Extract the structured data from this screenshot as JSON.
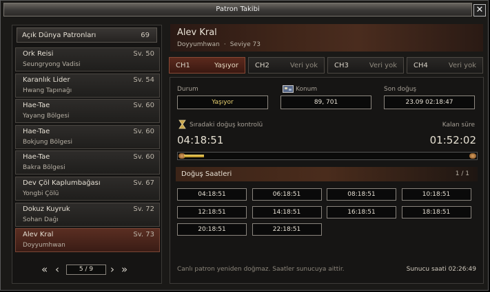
{
  "window": {
    "title": "Patron Takibi",
    "close_label": "✕"
  },
  "list": {
    "header_label": "Açık Dünya Patronları",
    "header_count": "69",
    "items": [
      {
        "name": "Ork Reisi",
        "level": "Sv. 50",
        "zone": "Seungryong Vadisi"
      },
      {
        "name": "Karanlık Lider",
        "level": "Sv. 54",
        "zone": "Hwang Tapınağı"
      },
      {
        "name": "Hae-Tae",
        "level": "Sv. 60",
        "zone": "Yayang Bölgesi"
      },
      {
        "name": "Hae-Tae",
        "level": "Sv. 60",
        "zone": "Bokjung Bölgesi"
      },
      {
        "name": "Hae-Tae",
        "level": "Sv. 60",
        "zone": "Bakra Bölgesi"
      },
      {
        "name": "Dev Çöl Kaplumbağası",
        "level": "Sv. 67",
        "zone": "Yongbi Çölü"
      },
      {
        "name": "Dokuz Kuyruk",
        "level": "Sv. 72",
        "zone": "Sohan Dağı"
      },
      {
        "name": "Alev Kral",
        "level": "Sv. 73",
        "zone": "Doyyumhwan"
      }
    ],
    "active_index": 7,
    "pager": {
      "label": "5 / 9",
      "first": "«",
      "prev": "‹",
      "next": "›",
      "last": "»"
    }
  },
  "boss": {
    "name": "Alev Kral",
    "zone": "Doyyumhwan",
    "separator": "·",
    "level": "Seviye 73"
  },
  "tabs": [
    {
      "name": "CH1",
      "status": "Yaşıyor"
    },
    {
      "name": "CH2",
      "status": "Veri yok"
    },
    {
      "name": "CH3",
      "status": "Veri yok"
    },
    {
      "name": "CH4",
      "status": "Veri yok"
    }
  ],
  "active_tab": 0,
  "details": {
    "status_label": "Durum",
    "status_value": "Yaşıyor",
    "location_label": "Konum",
    "location_value": "89, 701",
    "last_spawn_label": "Son doğuş",
    "last_spawn_value": "23.09 02:18:47",
    "next_check_label": "Sıradaki doğuş kontrolü",
    "next_check_value": "04:18:51",
    "remaining_label": "Kalan süre",
    "remaining_value": "01:52:02",
    "progress_fraction": 0.07
  },
  "spawns": {
    "title": "Doğuş Saatleri",
    "page": "1 / 1",
    "times": [
      "04:18:51",
      "06:18:51",
      "08:18:51",
      "10:18:51",
      "12:18:51",
      "14:18:51",
      "16:18:51",
      "18:18:51",
      "20:18:51",
      "22:18:51"
    ]
  },
  "footer": {
    "note": "Canlı patron yeniden doğmaz. Saatler sunucuya aittir.",
    "server_time": "Sunucu saati 02:26:49"
  },
  "colors": {
    "status_alive": "#e8d070",
    "active_red": "#5a2e22"
  },
  "icons": {
    "location": "map-icon",
    "hourglass": "hourglass-icon"
  }
}
